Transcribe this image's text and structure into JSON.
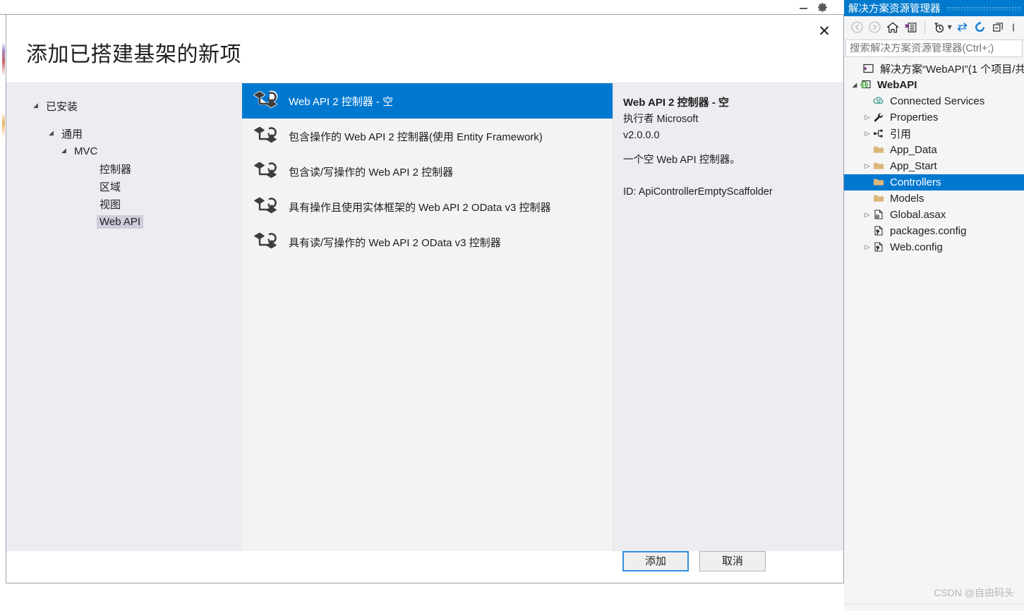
{
  "vs_background": {
    "minimize_icon": "minimize-icon",
    "settings_icon": "gear-icon"
  },
  "dialog": {
    "title": "添加已搭建基架的新项",
    "close_label": "✕",
    "tree": [
      {
        "label": "已安装",
        "level": 0,
        "expander": "◢",
        "selected": false
      },
      {
        "label": "通用",
        "level": 1,
        "expander": "◢",
        "selected": false
      },
      {
        "label": "MVC",
        "level": 2,
        "expander": "◢",
        "selected": false
      },
      {
        "label": "控制器",
        "level": 3,
        "expander": "",
        "selected": false
      },
      {
        "label": "区域",
        "level": 3,
        "expander": "",
        "selected": false
      },
      {
        "label": "视图",
        "level": 3,
        "expander": "",
        "selected": false
      },
      {
        "label": "Web API",
        "level": 3,
        "expander": "",
        "selected": true
      }
    ],
    "scaffolds": [
      {
        "label": "Web API 2 控制器 - 空",
        "icon": "scaffold-icon",
        "selected": true
      },
      {
        "label": "包含操作的 Web API 2 控制器(使用 Entity Framework)",
        "icon": "scaffold-icon",
        "selected": false
      },
      {
        "label": "包含读/写操作的 Web API 2 控制器",
        "icon": "scaffold-icon",
        "selected": false
      },
      {
        "label": "具有操作且使用实体框架的 Web API 2 OData v3 控制器",
        "icon": "scaffold-icon",
        "selected": false
      },
      {
        "label": "具有读/写操作的 Web API 2 OData v3 控制器",
        "icon": "scaffold-icon",
        "selected": false
      }
    ],
    "details": {
      "title": "Web API 2 控制器 - 空",
      "author": "执行者 Microsoft",
      "version": "v2.0.0.0",
      "description": "一个空 Web API 控制器。",
      "id": "ID: ApiControllerEmptyScaffolder"
    },
    "buttons": {
      "add": "添加",
      "cancel": "取消"
    }
  },
  "solution_explorer": {
    "title": "解决方案资源管理器",
    "toolbar": [
      {
        "name": "back-icon",
        "enabled": false
      },
      {
        "name": "forward-icon",
        "enabled": false
      },
      {
        "name": "home-icon",
        "enabled": true
      },
      {
        "name": "properties-window-icon",
        "enabled": true
      },
      {
        "name": "pending-changes-filter-icon",
        "enabled": true
      },
      {
        "name": "sync-with-active-document-icon",
        "enabled": true
      },
      {
        "name": "refresh-icon",
        "enabled": true
      },
      {
        "name": "collapse-all-icon",
        "enabled": true
      }
    ],
    "search": {
      "placeholder": "搜索解决方案资源管理器(Ctrl+;)",
      "value": ""
    },
    "tree": [
      {
        "label": "解决方案“WebAPI”(1 个项目/共",
        "icon": "solution-icon",
        "indent": 0,
        "expander": "",
        "bold": false,
        "selected": false
      },
      {
        "label": "WebAPI",
        "icon": "web-project-icon",
        "indent": 1,
        "expander": "◢",
        "bold": true,
        "selected": false
      },
      {
        "label": "Connected Services",
        "icon": "connected-services-icon",
        "indent": 2,
        "expander": "",
        "bold": false,
        "selected": false
      },
      {
        "label": "Properties",
        "icon": "wrench-icon",
        "indent": 2,
        "expander": "▷",
        "bold": false,
        "selected": false
      },
      {
        "label": "引用",
        "icon": "references-icon",
        "indent": 2,
        "expander": "▷",
        "bold": false,
        "selected": false
      },
      {
        "label": "App_Data",
        "icon": "folder-icon",
        "indent": 2,
        "expander": "",
        "bold": false,
        "selected": false
      },
      {
        "label": "App_Start",
        "icon": "folder-icon",
        "indent": 2,
        "expander": "▷",
        "bold": false,
        "selected": false
      },
      {
        "label": "Controllers",
        "icon": "folder-icon",
        "indent": 2,
        "expander": "",
        "bold": false,
        "selected": true
      },
      {
        "label": "Models",
        "icon": "folder-icon",
        "indent": 2,
        "expander": "",
        "bold": false,
        "selected": false
      },
      {
        "label": "Global.asax",
        "icon": "asax-file-icon",
        "indent": 2,
        "expander": "▷",
        "bold": false,
        "selected": false
      },
      {
        "label": "packages.config",
        "icon": "config-file-icon",
        "indent": 2,
        "expander": "",
        "bold": false,
        "selected": false
      },
      {
        "label": "Web.config",
        "icon": "config-file-icon",
        "indent": 2,
        "expander": "▷",
        "bold": false,
        "selected": false
      }
    ]
  },
  "watermark": "CSDN @自由码头",
  "colors": {
    "accent_blue": "#0078d0",
    "titlebar_blue": "#007acc",
    "panel_gray": "#edecf1",
    "list_gray": "#f3f3f3",
    "folder_tan": "#dcb67a"
  }
}
